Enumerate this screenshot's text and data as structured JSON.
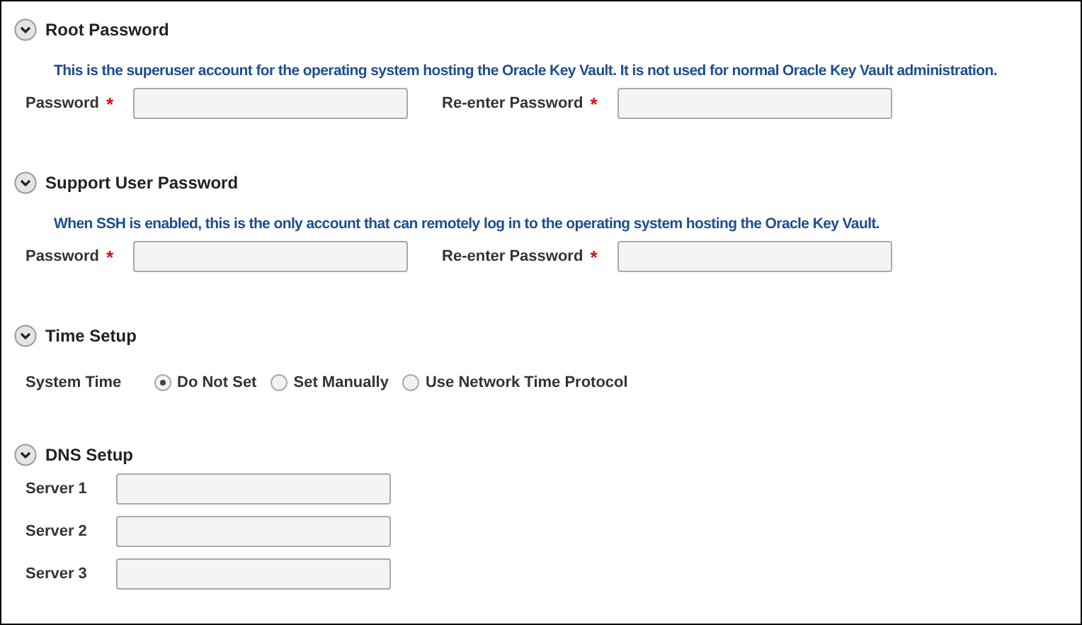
{
  "sections": [
    {
      "kind": "passwords",
      "title": "Root Password",
      "expanded": true,
      "description": "This is the superuser account for the operating system hosting the Oracle Key Vault. It is not used for normal Oracle Key Vault administration.",
      "fields": [
        {
          "label": "Password",
          "required_mark": "*"
        },
        {
          "label": "Re-enter Password",
          "required_mark": "*"
        }
      ]
    },
    {
      "kind": "passwords",
      "title": "Support User Password",
      "expanded": true,
      "description": "When SSH is enabled, this is the only account that can remotely log in to the operating system hosting the Oracle Key Vault.",
      "fields": [
        {
          "label": "Password",
          "required_mark": "*"
        },
        {
          "label": "Re-enter Password",
          "required_mark": "*"
        }
      ]
    },
    {
      "kind": "time",
      "title": "Time Setup",
      "expanded": true,
      "label": "System Time",
      "options": [
        {
          "label": "Do Not Set",
          "selected": true
        },
        {
          "label": "Set Manually",
          "selected": false
        },
        {
          "label": "Use Network Time Protocol",
          "selected": false
        }
      ]
    },
    {
      "kind": "dns",
      "title": "DNS Setup",
      "expanded": true,
      "fields": [
        {
          "label": "Server 1"
        },
        {
          "label": "Server 2"
        },
        {
          "label": "Server 3"
        }
      ]
    }
  ]
}
